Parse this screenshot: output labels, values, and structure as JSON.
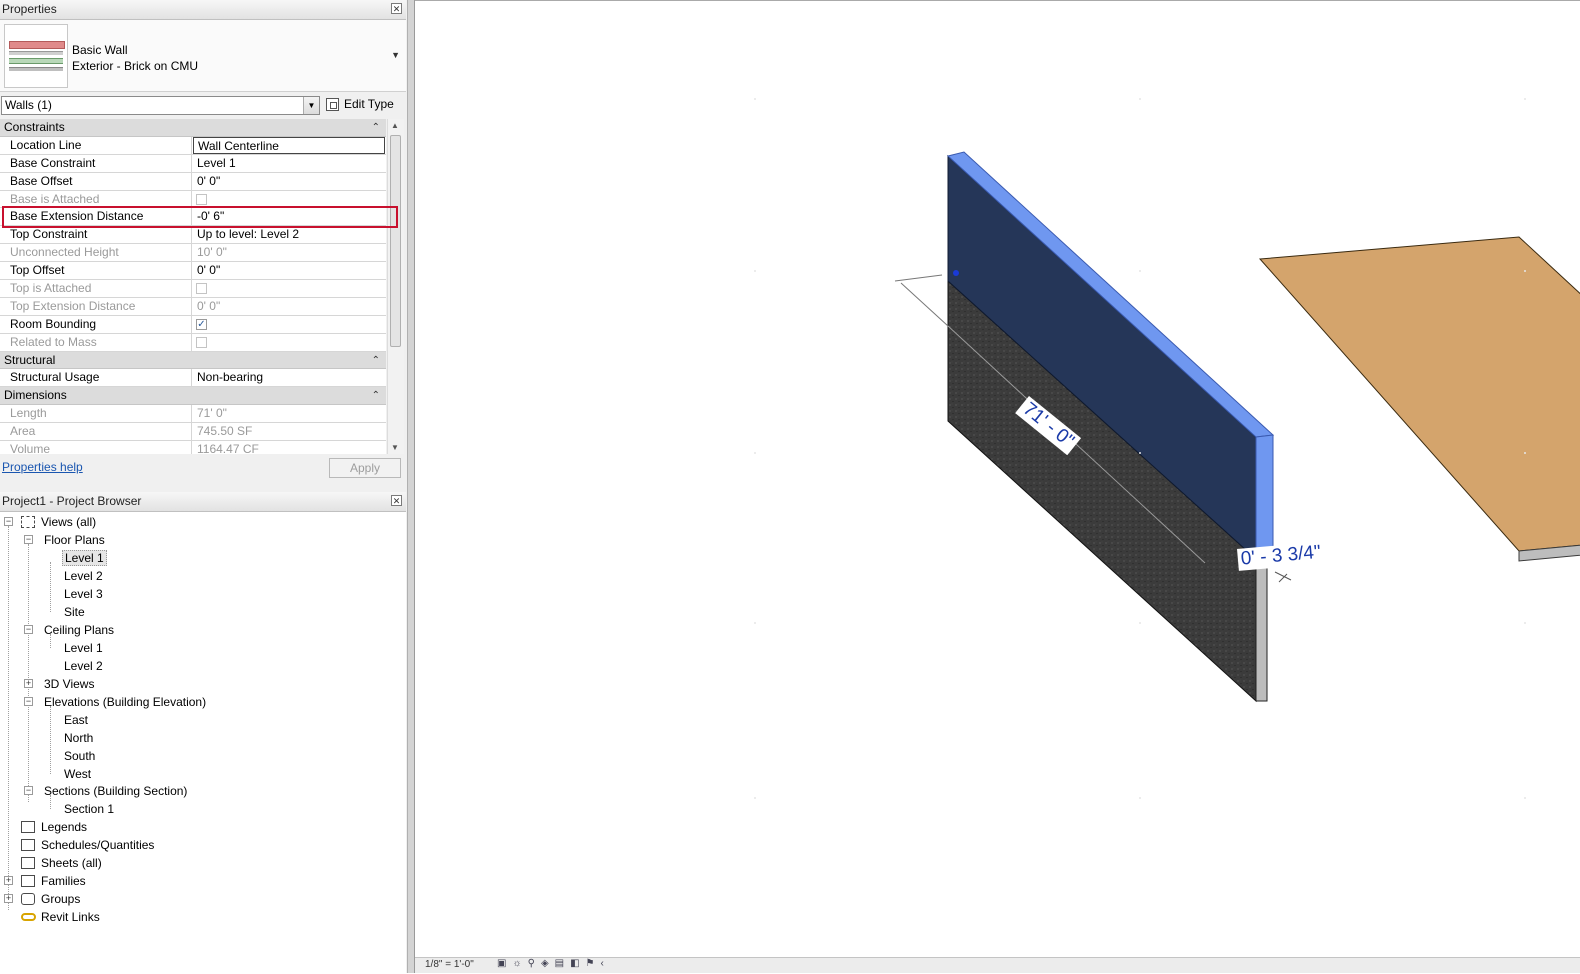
{
  "properties": {
    "title": "Properties",
    "close_icon": "close-icon",
    "type_family": "Basic Wall",
    "type_name": "Exterior - Brick on CMU",
    "filter": "Walls (1)",
    "edit_type": "Edit Type",
    "sections": {
      "constraints": "Constraints",
      "structural": "Structural",
      "dimensions": "Dimensions"
    },
    "rows": [
      {
        "name": "Location Line",
        "value": "Wall Centerline"
      },
      {
        "name": "Base Constraint",
        "value": "Level 1"
      },
      {
        "name": "Base Offset",
        "value": "0'  0\""
      },
      {
        "name": "Base is Attached",
        "value": ""
      },
      {
        "name": "Base Extension Distance",
        "value": "-0'  6\""
      },
      {
        "name": "Top Constraint",
        "value": "Up to level: Level 2"
      },
      {
        "name": "Unconnected Height",
        "value": "10'  0\""
      },
      {
        "name": "Top Offset",
        "value": "0'  0\""
      },
      {
        "name": "Top is Attached",
        "value": ""
      },
      {
        "name": "Top Extension Distance",
        "value": "0'  0\""
      },
      {
        "name": "Room Bounding",
        "value": "✓"
      },
      {
        "name": "Related to Mass",
        "value": ""
      },
      {
        "name": "Structural Usage",
        "value": "Non-bearing"
      },
      {
        "name": "Length",
        "value": "71'  0\""
      },
      {
        "name": "Area",
        "value": "745.50 SF"
      },
      {
        "name": "Volume",
        "value": "1164.47 CF"
      }
    ],
    "help": "Properties help",
    "apply": "Apply"
  },
  "browser": {
    "title": "Project1 - Project Browser",
    "items": {
      "views_all": "Views (all)",
      "floor_plans": "Floor Plans",
      "fp_level1": "Level 1",
      "fp_level2": "Level 2",
      "fp_level3": "Level 3",
      "fp_site": "Site",
      "ceiling_plans": "Ceiling Plans",
      "cp_level1": "Level 1",
      "cp_level2": "Level 2",
      "views_3d": "3D Views",
      "elevations": "Elevations (Building Elevation)",
      "el_east": "East",
      "el_north": "North",
      "el_south": "South",
      "el_west": "West",
      "sections": "Sections (Building Section)",
      "section1": "Section 1",
      "legends": "Legends",
      "schedules": "Schedules/Quantities",
      "sheets": "Sheets (all)",
      "families": "Families",
      "groups": "Groups",
      "revit_links": "Revit Links"
    }
  },
  "viewport": {
    "dim_length": "71' - 0\"",
    "dim_thickness": "0' - 3 3/4\"",
    "wall_face_color": "#253658",
    "wall_edge_color": "#6f97f0",
    "floor_color": "#d4a46c",
    "foundation_color": "#3d3d3d",
    "scale_label": "1/8\" = 1'-0\""
  }
}
